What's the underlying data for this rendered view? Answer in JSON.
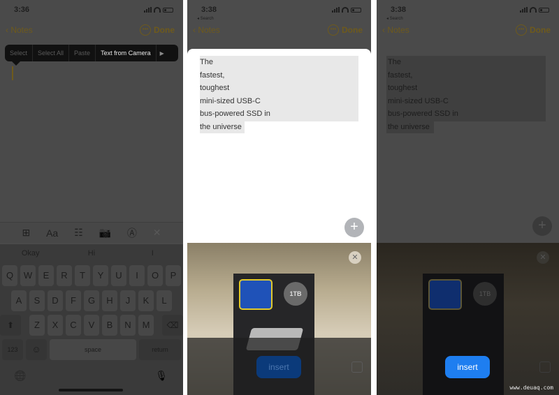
{
  "panels": [
    {
      "time": "3:36",
      "nav": {
        "back_label": "Notes",
        "more_icon": "ellipsis-circle-icon",
        "done_label": "Done"
      },
      "edit_menu": [
        "Select",
        "Select All",
        "Paste",
        "Text from Camera"
      ],
      "edit_menu_more": "▶",
      "format_bar": {
        "table": "⊞",
        "text_style": "Aa",
        "checklist": "☷",
        "camera": "📷",
        "markup": "Ⓐ",
        "close": "✕"
      },
      "suggestions": [
        "Okay",
        "Hi",
        "I"
      ],
      "keyboard": {
        "row1": [
          "Q",
          "W",
          "E",
          "R",
          "T",
          "Y",
          "U",
          "I",
          "O",
          "P"
        ],
        "row2": [
          "A",
          "S",
          "D",
          "F",
          "G",
          "H",
          "J",
          "K",
          "L"
        ],
        "row3": [
          "Z",
          "X",
          "C",
          "V",
          "B",
          "N",
          "M"
        ],
        "shift": "⬆",
        "delete": "⌫",
        "numbers": "123",
        "emoji": "☺",
        "space": "space",
        "return": "return",
        "globe": "🌐",
        "mic": "🎙"
      }
    },
    {
      "time": "3:38",
      "back_app": "◂ Search",
      "nav": {
        "back_label": "Notes",
        "done_label": "Done"
      },
      "captured_lines": [
        "The",
        "fastest,",
        "toughest",
        "mini-sized USB-C",
        "bus-powered SSD in",
        "the universe"
      ],
      "plus": "+",
      "close": "✕",
      "badge": "1TB",
      "insert_label": "insert"
    },
    {
      "time": "3:38",
      "back_app": "◂ Search",
      "nav": {
        "back_label": "Notes",
        "done_label": "Done"
      },
      "captured_lines": [
        "The",
        "fastest,",
        "toughest",
        "mini-sized USB-C",
        "bus-powered SSD in",
        "the universe"
      ],
      "plus": "+",
      "close": "✕",
      "badge": "1TB",
      "insert_label": "insert"
    }
  ],
  "watermark": "www.deuaq.com",
  "colors": {
    "accent": "#e0b23a",
    "insert_blue": "#1e7ef0",
    "scan_bracket": "#e1c92c"
  }
}
